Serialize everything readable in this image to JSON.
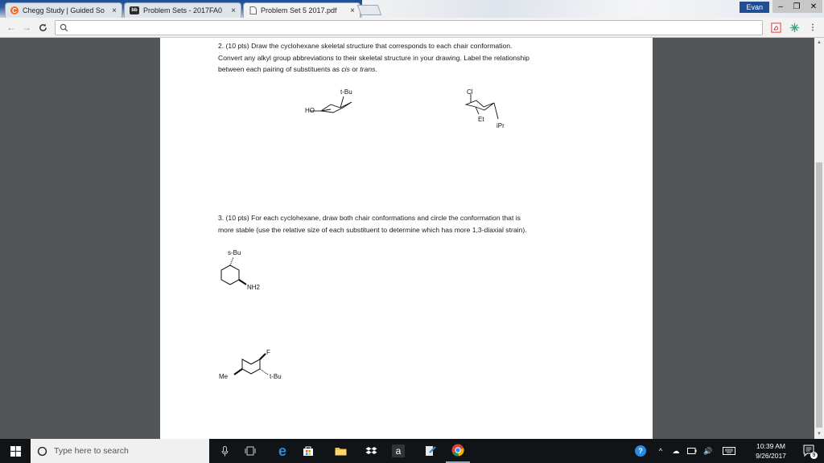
{
  "browser": {
    "tabs": [
      {
        "label": "Chegg Study | Guided So",
        "icon": "chegg-icon",
        "close": "×"
      },
      {
        "label": "Problem Sets - 2017FA0",
        "icon": "bb",
        "close": "×"
      },
      {
        "label": "Problem Set 5 2017.pdf",
        "icon": "doc-icon",
        "close": "×"
      }
    ],
    "user": "Evan",
    "window_controls": {
      "minimize": "–",
      "restore": "❐",
      "close": "✕"
    }
  },
  "document": {
    "q2": {
      "line1": "2. (10 pts) Draw the cyclohexane skeletal structure that corresponds to each chair conformation.",
      "line2": "Convert any alkyl group abbreviations to their skeletal structure in your drawing. Label the relationship",
      "line3_pre": "between each pairing of substituents as ",
      "cis": "cis",
      "or": " or ",
      "trans": "trans",
      "end": "."
    },
    "q3": {
      "line1": "3. (10 pts) For each cyclohexane, draw both chair conformations and circle the conformation that is",
      "line2": "more stable (use the relative size of each substituent to determine which has more 1,3-diaxial strain)."
    },
    "molecules": {
      "m1": {
        "top_label": "t-Bu",
        "left_label": "HO"
      },
      "m2": {
        "top_label": "Cl",
        "mid_label": "Et",
        "bottom_label": "iPr"
      },
      "m3": {
        "top_label": "s-Bu",
        "right_label": "NH2"
      },
      "m4": {
        "top_label": "F",
        "left_label": "Me",
        "right_label": "t-Bu"
      }
    }
  },
  "taskbar": {
    "search_placeholder": "Type here to search",
    "time": "10:39 AM",
    "date": "9/26/2017",
    "amazon_glyph": "a",
    "notification_count": "9"
  }
}
